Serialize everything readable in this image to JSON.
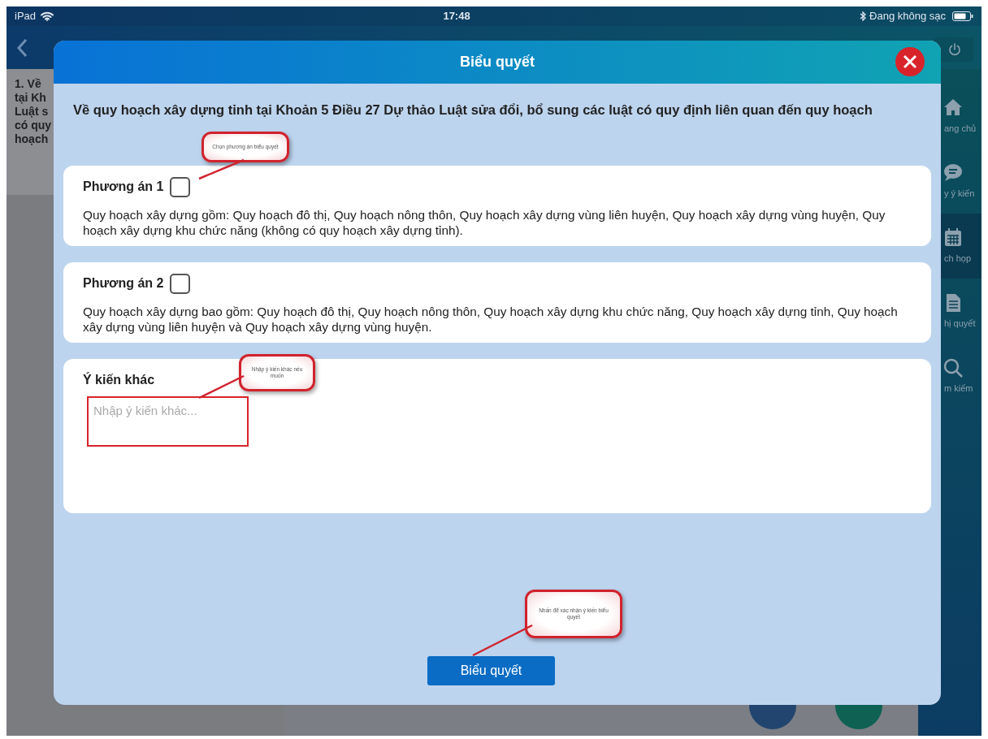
{
  "status_bar": {
    "device": "iPad",
    "time": "17:48",
    "battery_text": "Đang không sạc"
  },
  "background": {
    "list_lines": [
      "1. Về",
      "tại Kh",
      "Luật s",
      "có quy",
      "hoạch"
    ],
    "sidebar": [
      {
        "kind": "home",
        "label": "ang chủ",
        "selected": false
      },
      {
        "kind": "chat",
        "label": "y ý kiến",
        "selected": false
      },
      {
        "kind": "calendar",
        "label": "ch họp",
        "selected": true
      },
      {
        "kind": "document",
        "label": "hị quyết",
        "selected": false
      },
      {
        "kind": "search",
        "label": "m kiếm",
        "selected": false
      }
    ]
  },
  "dialog": {
    "title": "Biểu quyết",
    "question": "Về quy hoạch xây dựng tỉnh tại Khoản 5 Điều 27 Dự thảo Luật sửa đổi, bổ sung các luật có quy định liên quan đến quy hoạch",
    "options": [
      {
        "label": "Phương án 1",
        "checked": false,
        "text": "Quy hoạch xây dựng gồm: Quy hoạch đô thị, Quy hoạch nông thôn, Quy hoạch xây dựng vùng liên huyện, Quy hoạch xây dựng vùng huyện, Quy hoạch xây dựng khu chức năng (không có quy hoạch xây dựng tỉnh)."
      },
      {
        "label": "Phương án 2",
        "checked": false,
        "text": "Quy hoạch xây dựng bao gồm: Quy hoạch đô thị, Quy hoạch nông thôn, Quy hoạch xây dựng khu chức năng, Quy hoạch xây dựng tỉnh, Quy hoạch xây dựng vùng liên huyện và Quy hoạch xây dựng vùng huyện."
      }
    ],
    "other": {
      "label": "Ý kiến khác",
      "placeholder": "Nhập ý kiến khác..."
    },
    "submit": "Biểu quyết"
  },
  "annotations": [
    {
      "text": "Chọn phương án biểu quyết"
    },
    {
      "text": "Nhập ý kiến khác nếu muốn"
    },
    {
      "text": "Nhấn để xác nhận ý kiến biểu quyết"
    }
  ]
}
